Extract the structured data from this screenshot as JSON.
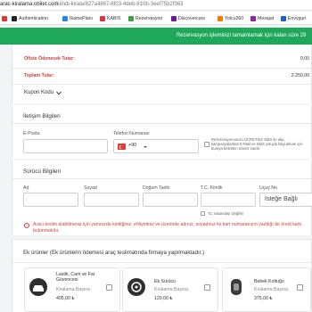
{
  "browser": {
    "url_host": "arac-kiralama.obilet.com",
    "url_path": "/simdi-kirala/827a4867-8f03-4deb-810b-3eef75b2f363"
  },
  "bookmarks": [
    {
      "label": "",
      "color": "#d23c3c"
    },
    {
      "label": "Authentication",
      "color": "#222222"
    },
    {
      "label": "İkamePlanı",
      "color": "#1e88e5"
    },
    {
      "label": "KABIS",
      "color": "#d33b3b"
    },
    {
      "label": "Rezervasyon",
      "color": "#43a047"
    },
    {
      "label": "Discovercars",
      "color": "#6a1b9a"
    },
    {
      "label": "Yolcu360",
      "color": "#f57c00"
    },
    {
      "label": "Mesajat",
      "color": "#8e24aa"
    },
    {
      "label": "Envygun",
      "color": "#1565c0"
    }
  ],
  "banner": {
    "text": "Rezervasyon işleminizi tamamlamak için kalan süre 29"
  },
  "summary": {
    "office_label": "Ofiste Ödenecek Tutar:",
    "office_value": "0,00",
    "total_label": "Toplam Tutar:",
    "total_value": "2.250,00",
    "coupon_label": "Kupon Kodu",
    "coupon_icon": "chevron-down-icon"
  },
  "contact": {
    "title": "İletişim Bilgileri",
    "email_label": "E-Posta",
    "phone_label": "Telefon Numarası",
    "country_code": "+90",
    "sms_consent": "Rezervasyonunuzu ÜCRETSİZ SMS ile alıp, kampanyalardan E-Mail ve SMS yoluyla bilgi almak için buraya belirtilen izinimi vardır."
  },
  "driver": {
    "title": "Sürücü Bilgileri",
    "name_label": "Ad",
    "surname_label": "Soyad",
    "birth_label": "Doğum Tarihi",
    "id_label": "T.C. Kimlik",
    "flight_label": "Uçuş No",
    "flight_placeholder": "İsteğe Bağlı",
    "not_citizen": "TC Vatandaşı Değilim",
    "warning": "Aracı teslim alabilmeniz için yanınızda kimliğiniz, ehliyetiniz ve üzerinde adınız, soyadınız ile kart numaranızın yazdığı bir kredi kartı bulunmalıdır."
  },
  "extras": {
    "title": "Ek ürünler (Ek ürünlerin ödemesi araç teslimatında firmaya yapılmaktadır.)",
    "items": [
      {
        "name": "Lastik, Cam ve Far Güvencesi",
        "unit": "Kiralama Başına",
        "price": "405,00 ₺",
        "icon": "car-shield-icon"
      },
      {
        "name": "Ek Sürücü",
        "unit": "Kiralama Başına",
        "price": "120,00 ₺",
        "icon": "driver-icon"
      },
      {
        "name": "Bebek Koltuğu",
        "unit": "Kiralama Başına",
        "price": "375,00 ₺",
        "icon": "baby-seat-icon"
      }
    ]
  }
}
